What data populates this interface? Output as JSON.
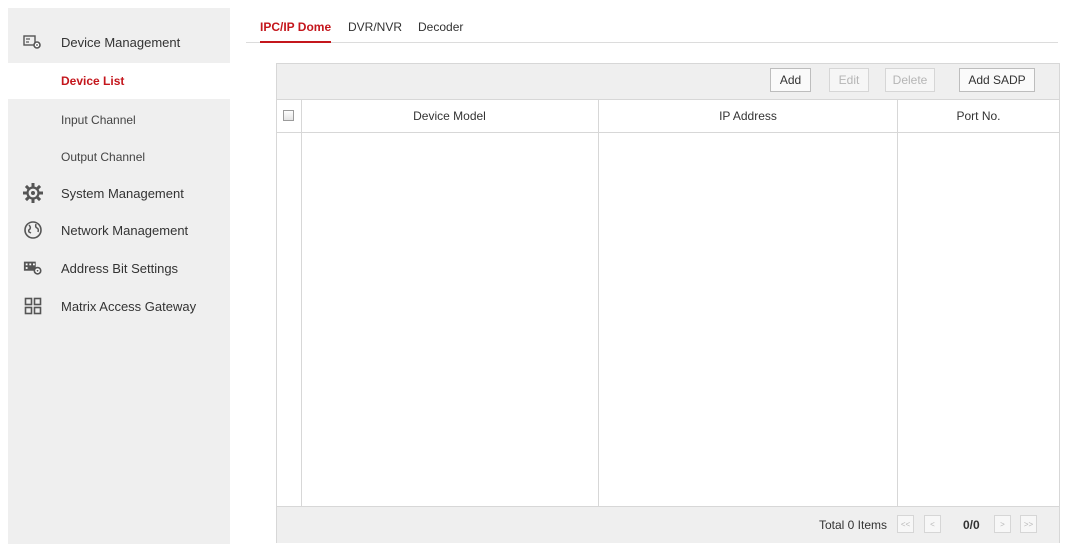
{
  "sidebar": {
    "items": [
      {
        "label": "Device Management",
        "icon": "device-management-icon"
      },
      {
        "label": "Device List"
      },
      {
        "label": "Input Channel"
      },
      {
        "label": "Output Channel"
      },
      {
        "label": "System Management",
        "icon": "gear-icon"
      },
      {
        "label": "Network Management",
        "icon": "globe-icon"
      },
      {
        "label": "Address Bit Settings",
        "icon": "address-bit-icon"
      },
      {
        "label": "Matrix Access Gateway",
        "icon": "grid-icon"
      }
    ],
    "active": "Device List"
  },
  "tabs": [
    {
      "label": "IPC/IP Dome",
      "active": true
    },
    {
      "label": "DVR/NVR",
      "active": false
    },
    {
      "label": "Decoder",
      "active": false
    }
  ],
  "toolbar": {
    "add_label": "Add",
    "edit_label": "Edit",
    "delete_label": "Delete",
    "add_sadp_label": "Add SADP"
  },
  "table": {
    "columns": [
      "Device Model",
      "IP Address",
      "Port No."
    ],
    "rows": []
  },
  "footer": {
    "total": "Total 0 Items",
    "first": "<<",
    "prev": "<",
    "page": "0/0",
    "next": ">",
    "last": ">>"
  },
  "colors": {
    "accent": "#c4161c",
    "panel": "#efefef"
  }
}
